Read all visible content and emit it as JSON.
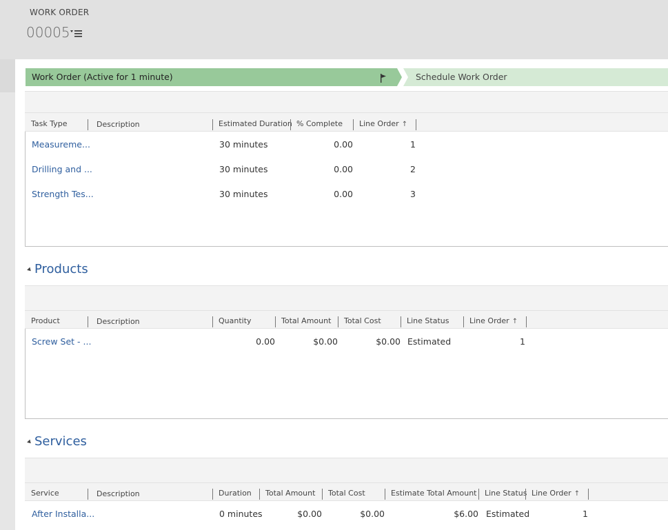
{
  "header": {
    "entity_label": "WORK ORDER",
    "record_id": "00005",
    "menu_icon": "list-menu-icon"
  },
  "process": {
    "active_stage": "Work Order (Active for 1 minute)",
    "next_stage": "Schedule Work Order",
    "flag_icon": "flag-icon",
    "colors": {
      "active": "#98c99a",
      "inactive": "#d5ead5"
    }
  },
  "tasks": {
    "columns": [
      "Task Type",
      "Description",
      "Estimated Duration",
      "% Complete",
      "Line Order"
    ],
    "rows": [
      {
        "task_type": "Measureme...",
        "description": "",
        "duration": "30 minutes",
        "complete": "0.00",
        "line_order": "1"
      },
      {
        "task_type": "Drilling and ...",
        "description": "",
        "duration": "30 minutes",
        "complete": "0.00",
        "line_order": "2"
      },
      {
        "task_type": "Strength Tes...",
        "description": "",
        "duration": "30 minutes",
        "complete": "0.00",
        "line_order": "3"
      }
    ]
  },
  "products": {
    "title": "Products",
    "columns": [
      "Product",
      "Description",
      "Quantity",
      "Total Amount",
      "Total Cost",
      "Line Status",
      "Line Order"
    ],
    "rows": [
      {
        "product": "Screw Set - ...",
        "description": "",
        "quantity": "0.00",
        "total_amount": "$0.00",
        "total_cost": "$0.00",
        "line_status": "Estimated",
        "line_order": "1"
      }
    ]
  },
  "services": {
    "title": "Services",
    "columns": [
      "Service",
      "Description",
      "Duration",
      "Total Amount",
      "Total Cost",
      "Estimate Total Amount",
      "Line Status",
      "Line Order"
    ],
    "rows": [
      {
        "service": "After Installa...",
        "description": "",
        "duration": "0 minutes",
        "total_amount": "$0.00",
        "total_cost": "$0.00",
        "estimate_total_amount": "$6.00",
        "line_status": "Estimated",
        "line_order": "1"
      }
    ]
  },
  "icons": {
    "sort": "sort-ascending-icon",
    "caret": "section-collapse-icon"
  },
  "colors": {
    "link": "#2e5e9e",
    "header_bg": "#e1e1e1",
    "toolbar_bg": "#f3f3f3"
  }
}
